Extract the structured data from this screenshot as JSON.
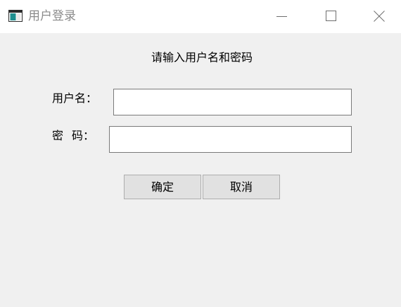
{
  "window": {
    "title": "用户登录",
    "controls": {
      "minimize": "minimize",
      "maximize": "maximize",
      "close": "close"
    }
  },
  "form": {
    "prompt": "请输入用户名和密码",
    "username_label": "用户名：",
    "username_value": "",
    "password_label_first": "密",
    "password_label_second": "码：",
    "password_value": ""
  },
  "buttons": {
    "ok_label": "确定",
    "cancel_label": "取消"
  },
  "icons": {
    "app": "window-app-icon",
    "minimize": "minimize-icon",
    "maximize": "maximize-icon",
    "close": "close-icon"
  },
  "colors": {
    "window_background": "#f0f0f0",
    "titlebar_background": "#ffffff",
    "title_text": "#8a8a8a",
    "button_background": "#e1e1e1",
    "button_border": "#adadad",
    "input_border": "#7a7a7a"
  }
}
